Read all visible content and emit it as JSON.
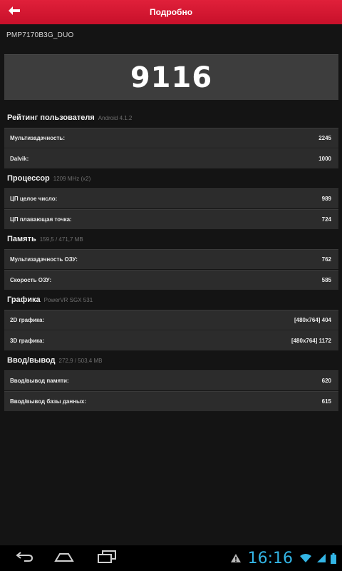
{
  "header": {
    "title": "Подробно",
    "accent_color": "#d4142f"
  },
  "device_name": "PMP7170B3G_DUO",
  "score": "9116",
  "sections": [
    {
      "title": "Рейтинг пользователя",
      "subtitle": "Android 4.1.2",
      "rows": [
        {
          "label": "Мультизадачность:",
          "value": "2245"
        },
        {
          "label": "Dalvik:",
          "value": "1000"
        }
      ]
    },
    {
      "title": "Процессор",
      "subtitle": "1209 MHz (x2)",
      "rows": [
        {
          "label": "ЦП целое число:",
          "value": "989"
        },
        {
          "label": "ЦП плавающая точка:",
          "value": "724"
        }
      ]
    },
    {
      "title": "Память",
      "subtitle": "159,5 / 471,7 MB",
      "rows": [
        {
          "label": "Мультизадачность ОЗУ:",
          "value": "762"
        },
        {
          "label": "Скорость ОЗУ:",
          "value": "585"
        }
      ]
    },
    {
      "title": "Графика",
      "subtitle": "PowerVR SGX 531",
      "rows": [
        {
          "label": "2D графика:",
          "value": "[480x764] 404"
        },
        {
          "label": "3D графика:",
          "value": "[480x764] 1172"
        }
      ]
    },
    {
      "title": "Ввод/вывод",
      "subtitle": "272,9 / 503,4 MB",
      "rows": [
        {
          "label": "Ввод/вывод памяти:",
          "value": "620"
        },
        {
          "label": "Ввод/вывод базы данных:",
          "value": "615"
        }
      ]
    }
  ],
  "system_bar": {
    "time": "16:16",
    "icons": [
      "back-nav-icon",
      "home-nav-icon",
      "recents-nav-icon",
      "warning-icon",
      "wifi-icon",
      "signal-icon",
      "battery-icon"
    ],
    "clock_color": "#33b5e5"
  }
}
